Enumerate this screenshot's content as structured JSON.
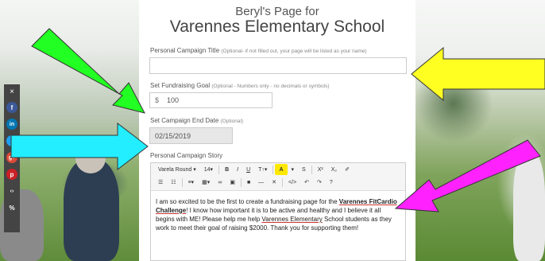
{
  "header": {
    "subtitle": "Beryl's Page for",
    "school": "Varennes Elementary School"
  },
  "campaign_title": {
    "label": "Personal Campaign Title",
    "hint": "(Optional- if not filled out, your page will be listed as your name)",
    "value": ""
  },
  "fundraising_goal": {
    "label": "Set Fundraising Goal",
    "hint": "(Optional - Numbers only - no decimals or symbols)",
    "prefix": "$",
    "value": "100"
  },
  "end_date": {
    "label": "Set Campaign End Date",
    "hint": "(Optional)",
    "value": "02/15/2019"
  },
  "story": {
    "label": "Personal Campaign Story",
    "toolbar_row1": [
      "Varela Round ▾",
      "14▾",
      "B",
      "I",
      "U",
      "T↑▾",
      "A",
      "▾",
      "S",
      "X²",
      "X₂",
      "✐"
    ],
    "toolbar_row2": [
      "☰",
      "☷",
      "≡▾",
      "▦▾",
      "∞",
      "▣",
      "■",
      "—",
      "✕",
      "</>",
      "↶",
      "↷",
      "?"
    ],
    "text_part1": "I am so excited to be the first to create a fundraising page for the ",
    "text_link": "Varennes FitCardio Challenge",
    "text_part2": "! I know how important it is to be active and healthy and I believe it all begins with ME!  Please help me help ",
    "text_ul": "Varennes Elementary",
    "text_part3": " School students as they work to meet their goal of raising $2000. Thank you for supporting them!"
  },
  "social": {
    "close": "×",
    "items": [
      "f",
      "in",
      "t",
      "g+",
      "p",
      "‹›",
      "%"
    ]
  },
  "colors": {
    "arrow_green": "#22ff22",
    "arrow_yellow": "#ffff22",
    "arrow_cyan": "#22eeff",
    "arrow_magenta": "#ff22ff"
  }
}
